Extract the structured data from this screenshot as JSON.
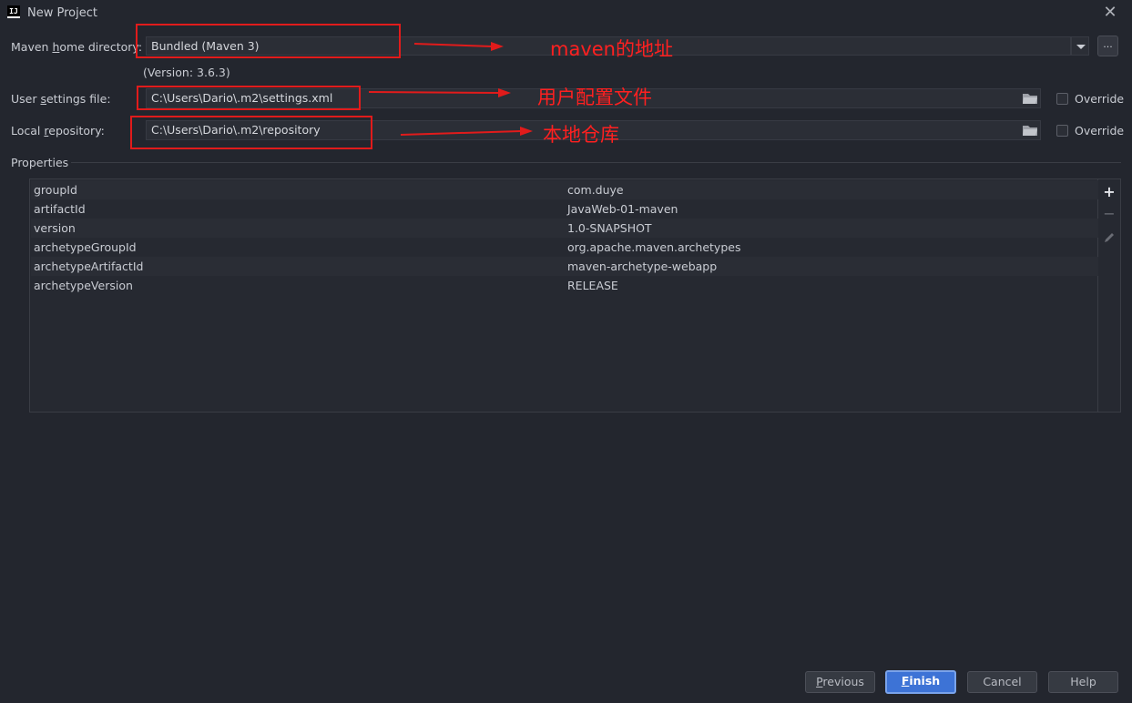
{
  "window": {
    "title": "New Project",
    "app_icon_text": "IJ"
  },
  "form": {
    "maven_home": {
      "label_pre": "Maven ",
      "label_u": "h",
      "label_post": "ome directory:",
      "value": "Bundled (Maven 3)",
      "version_note": "(Version: 3.6.3)",
      "browse_label": "..."
    },
    "user_settings": {
      "label_pre": "User ",
      "label_u": "s",
      "label_post": "ettings file:",
      "value": "C:\\Users\\Dario\\.m2\\settings.xml",
      "override_label": "Override"
    },
    "local_repo": {
      "label_pre": "Local ",
      "label_u": "r",
      "label_post": "epository:",
      "value": "C:\\Users\\Dario\\.m2\\repository",
      "override_label": "Override"
    }
  },
  "properties": {
    "title": "Properties",
    "rows": [
      {
        "key": "groupId",
        "value": "com.duye"
      },
      {
        "key": "artifactId",
        "value": "JavaWeb-01-maven"
      },
      {
        "key": "version",
        "value": "1.0-SNAPSHOT"
      },
      {
        "key": "archetypeGroupId",
        "value": "org.apache.maven.archetypes"
      },
      {
        "key": "archetypeArtifactId",
        "value": "maven-archetype-webapp"
      },
      {
        "key": "archetypeVersion",
        "value": "RELEASE"
      }
    ],
    "toolbar": {
      "add_icon": "plus-icon",
      "remove_icon": "minus-icon",
      "edit_icon": "pencil-icon"
    }
  },
  "annotations": {
    "maven_home": "maven的地址",
    "user_settings": "用户配置文件",
    "local_repo": "本地仓库"
  },
  "buttons": {
    "previous": {
      "underlined": "P",
      "rest": "revious"
    },
    "finish": {
      "underlined": "F",
      "rest": "inish"
    },
    "cancel": "Cancel",
    "help": "Help"
  },
  "colors": {
    "background": "#23262e",
    "field_bg": "#2b2e36",
    "annotation_red": "#e11b1b",
    "primary_button": "#3d73d6"
  }
}
